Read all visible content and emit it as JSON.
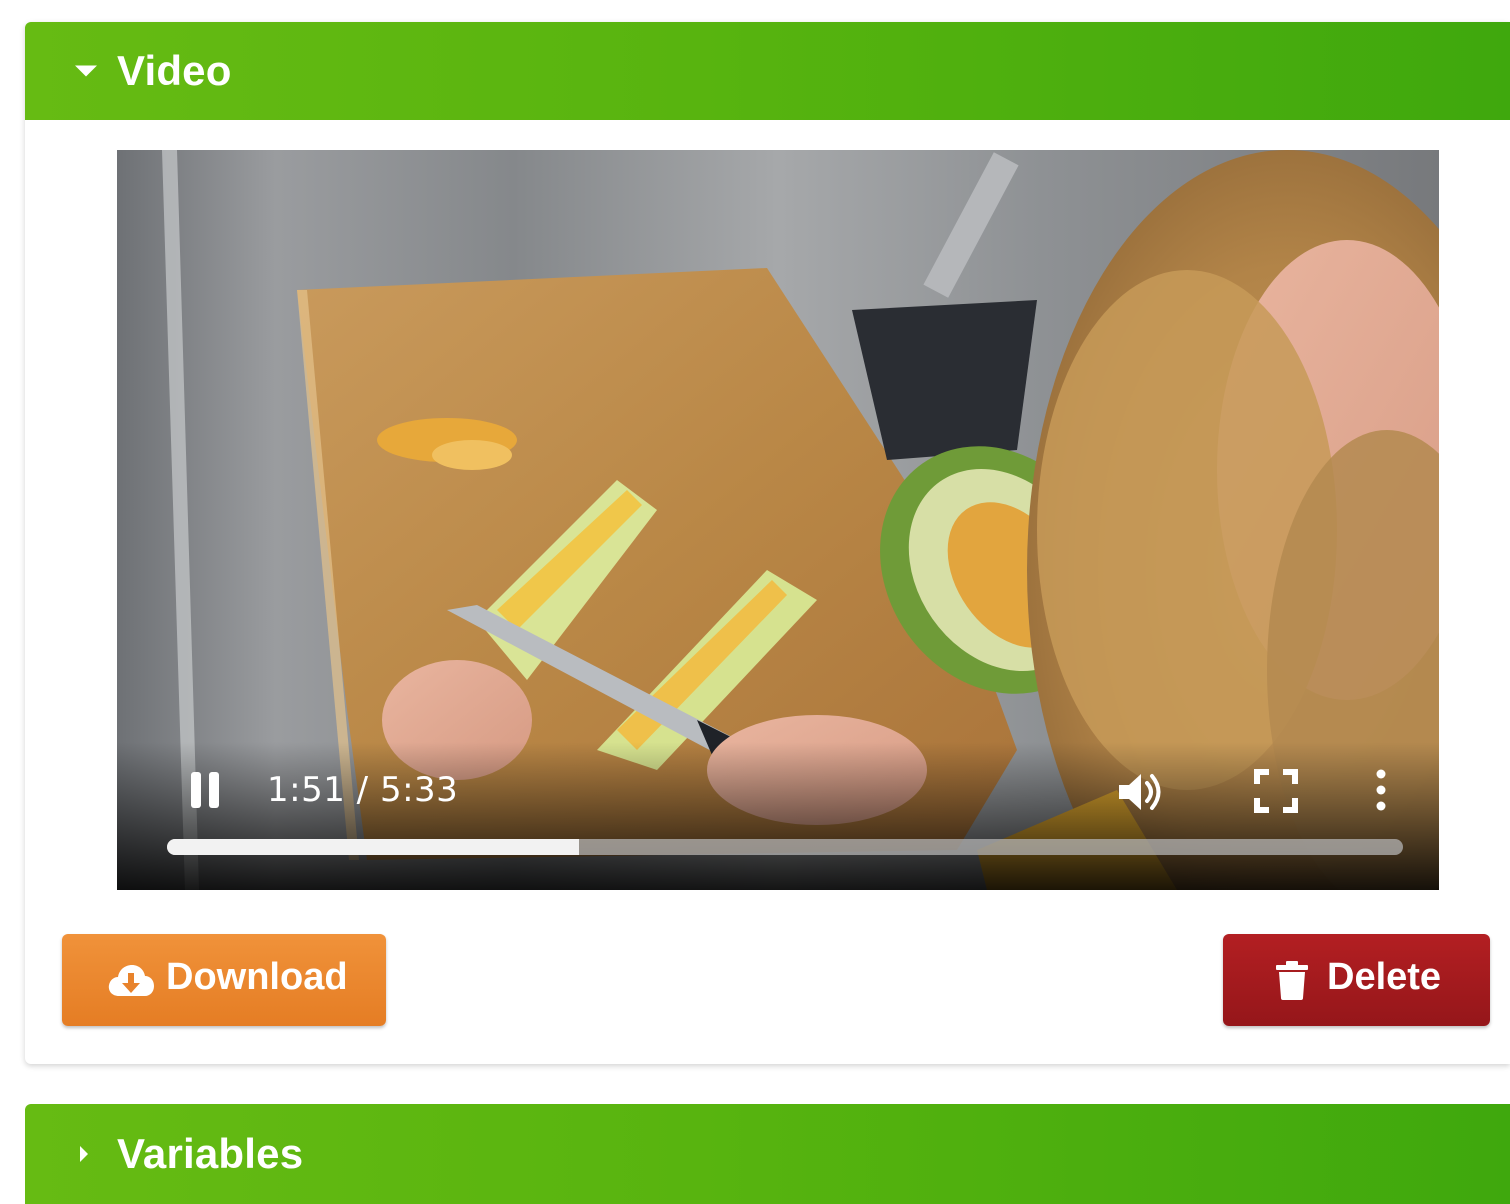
{
  "video_panel": {
    "title": "Video",
    "expanded": true,
    "toggle_icon": "caret-down-icon"
  },
  "player": {
    "state": "playing",
    "current_time": "1:51",
    "duration": "5:33",
    "time_display": "1:51 / 5:33",
    "progress_fraction": 0.333,
    "icons": {
      "pause": "pause-icon",
      "volume": "volume-icon",
      "fullscreen": "fullscreen-icon",
      "more": "more-vertical-icon"
    }
  },
  "actions": {
    "download_label": "Download",
    "download_icon": "cloud-download-icon",
    "download_color": "#e8832c",
    "delete_label": "Delete",
    "delete_icon": "trash-icon",
    "delete_color": "#a01a1e"
  },
  "variables_panel": {
    "title": "Variables",
    "expanded": false,
    "toggle_icon": "caret-right-icon"
  },
  "colors": {
    "panel_header": "#58b40f"
  }
}
